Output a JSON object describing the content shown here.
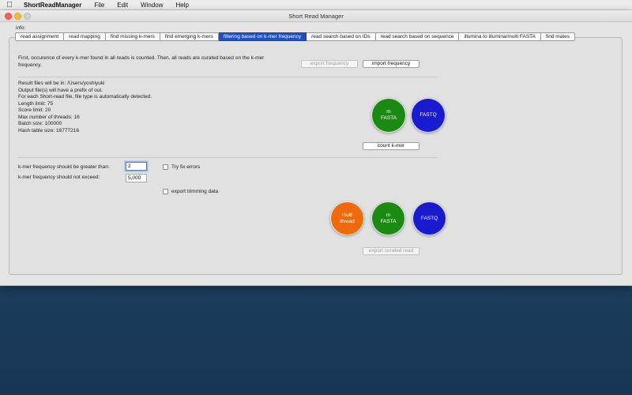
{
  "menubar": {
    "app_name": "ShortReadManager",
    "menus": [
      "File",
      "Edit",
      "Window",
      "Help"
    ]
  },
  "window": {
    "title": "Short Read Manager",
    "info_label": "info:"
  },
  "tabs": [
    {
      "label": "read assignment",
      "active": false
    },
    {
      "label": "read mapping",
      "active": false
    },
    {
      "label": "find missing k-mers",
      "active": false
    },
    {
      "label": "find emerging k-mers",
      "active": false
    },
    {
      "label": "filtering based on k-mer frequency",
      "active": true
    },
    {
      "label": "read search based on IDs",
      "active": false
    },
    {
      "label": "read search based on sequence",
      "active": false
    },
    {
      "label": "illumina to illumina/multi FASTA",
      "active": false
    },
    {
      "label": "find mates",
      "active": false
    }
  ],
  "panel": {
    "description": "First, occurence of every k-mer found in all reads is counted. Then, all reads are curated based on the k-mer frequency.",
    "export_frequency_button": "export frequency",
    "import_frequency_button": "import frequency",
    "info_lines": [
      "Result files will be in: /Users/yoshiyuki",
      "Output file(s) will have a prefix of out.",
      "For each Short-read file, file type is automatically detected.",
      "Length limit: 75",
      "Score limit: 20",
      "Max number of threads: 16",
      "Batch size: 100000",
      "Hash table size: 16777216"
    ],
    "count_circles": {
      "m_fasta": "m\nFASTA",
      "fastq": "FASTQ"
    },
    "count_kmer_button": "count k-mer",
    "greater_than_label": "k-mer frequency should be greater than:",
    "greater_than_value": "2",
    "not_exceed_label": "k-mer frequency should not exceed:",
    "not_exceed_value": "5,000",
    "try_fix_errors_label": "Try fix errors",
    "export_trimming_label": "export trimming data",
    "curate_circles": {
      "multi_thread": "multi\nthread",
      "m_fasta": "m\nFASTA",
      "fastq": "FASTQ"
    },
    "export_curated_button": "export curated read"
  },
  "colors": {
    "active_tab": "#1f4fc4",
    "green_circle": "#1a8a12",
    "blue_circle": "#1a1ad0",
    "orange_circle": "#ef6a0a",
    "desktop": "#1e3f5f"
  }
}
